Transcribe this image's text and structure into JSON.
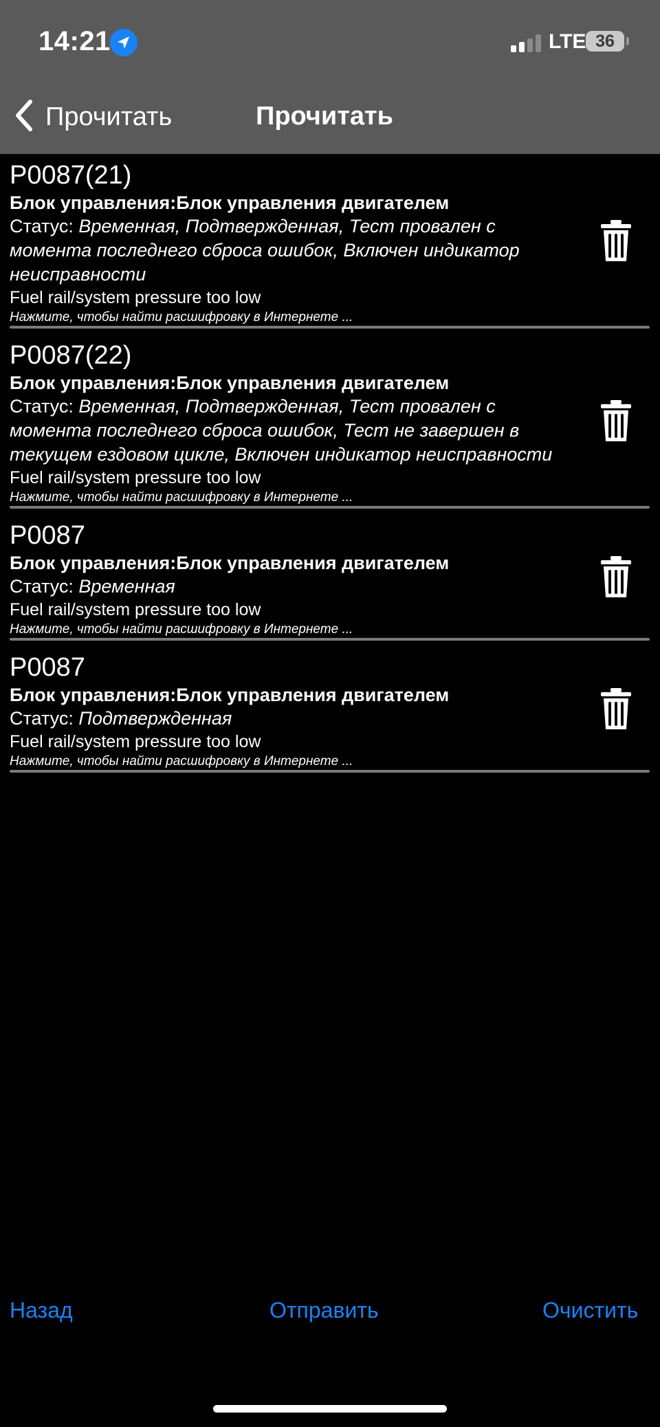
{
  "status_bar": {
    "time": "14:21",
    "network": "LTE",
    "battery": "36"
  },
  "nav": {
    "back_label": "Прочитать",
    "title": "Прочитать"
  },
  "entries": [
    {
      "code": "P0087(21)",
      "ecu": "Блок управления:Блок управления двигателем",
      "status_label": "Статус:",
      "status_value": "Временная, Подтвержденная, Тест провален с момента последнего сброса ошибок, Включен индикатор неисправности",
      "description": "Fuel rail/system pressure too low",
      "hint": "Нажмите, чтобы найти расшифровку в Интернете ..."
    },
    {
      "code": "P0087(22)",
      "ecu": "Блок управления:Блок управления двигателем",
      "status_label": "Статус:",
      "status_value": "Временная, Подтвержденная, Тест провален с момента последнего сброса ошибок, Тест не завершен в текущем ездовом цикле, Включен индикатор неисправности",
      "description": "Fuel rail/system pressure too low",
      "hint": "Нажмите, чтобы найти расшифровку в Интернете ..."
    },
    {
      "code": "P0087",
      "ecu": "Блок управления:Блок управления двигателем",
      "status_label": "Статус:",
      "status_value": "Временная",
      "description": "Fuel rail/system pressure too low",
      "hint": "Нажмите, чтобы найти расшифровку в Интернете ..."
    },
    {
      "code": "P0087",
      "ecu": "Блок управления:Блок управления двигателем",
      "status_label": "Статус:",
      "status_value": "Подтвержденная",
      "description": "Fuel rail/system pressure too low",
      "hint": "Нажмите, чтобы найти расшифровку в Интернете ..."
    }
  ],
  "bottom": {
    "back": "Назад",
    "send": "Отправить",
    "clear": "Очистить"
  },
  "colors": {
    "accent": "#1a82f7",
    "header_bg": "#5a5a5a",
    "background": "#000000"
  }
}
